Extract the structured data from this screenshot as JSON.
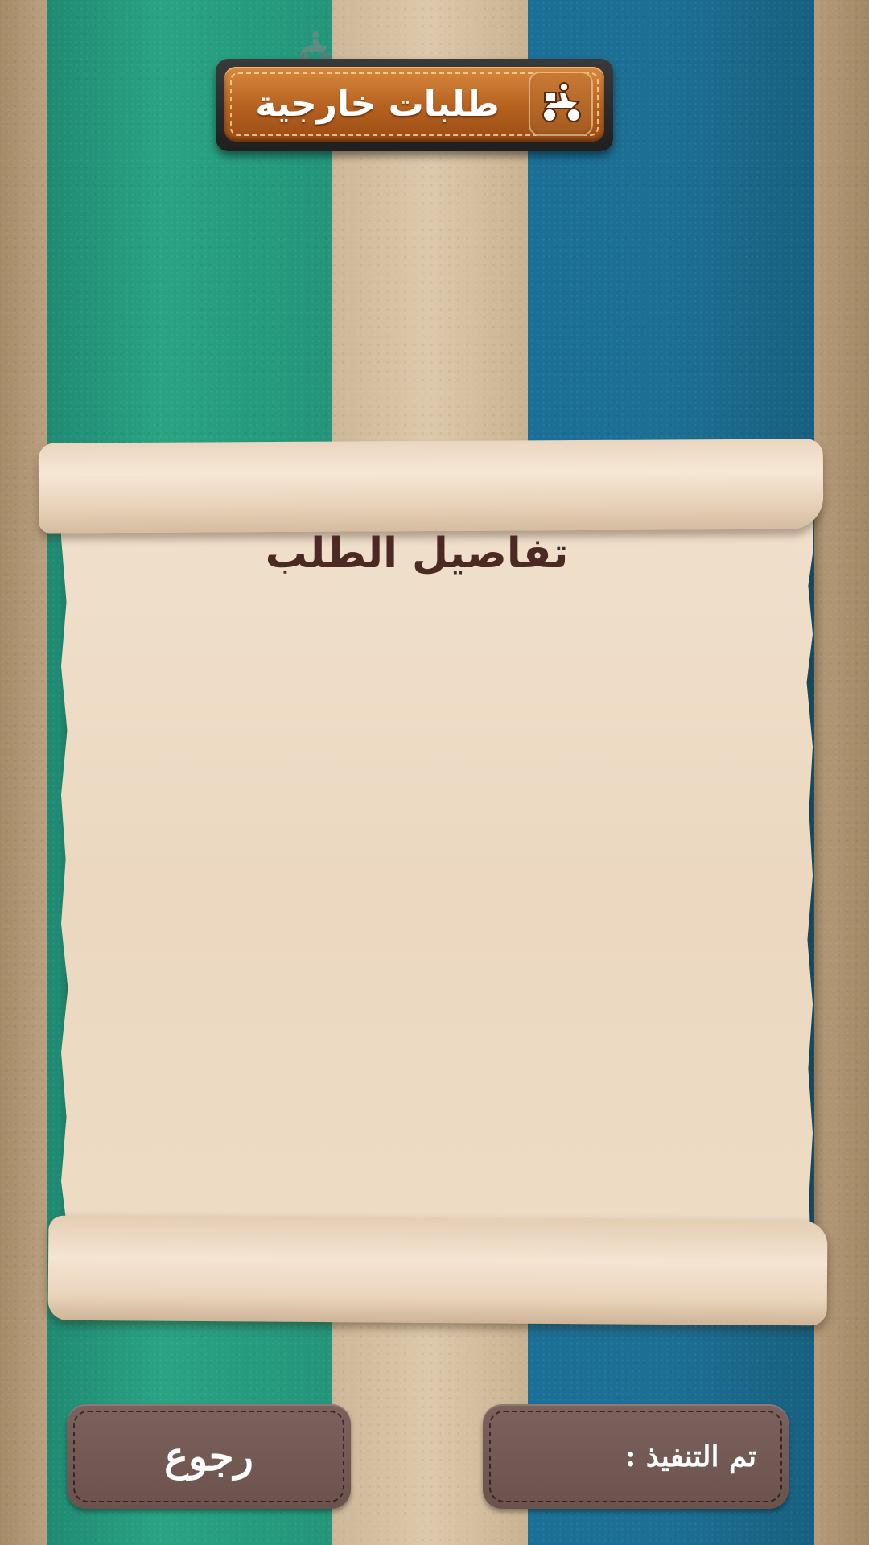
{
  "header": {
    "title": "طلبات خارجية",
    "icon": "delivery-scooter-icon"
  },
  "order_details": {
    "title": "تفاصيل الطلب"
  },
  "footer": {
    "back_label": "رجوع",
    "done_label": "تم التنفيذ :"
  },
  "colors": {
    "green_stripe": "#2aa383",
    "cream_stripe": "#dcc8aa",
    "blue_stripe": "#1d6f94",
    "header_leather": "#c2702c",
    "button_brown": "#735a54",
    "title_text": "#4a2a22"
  }
}
